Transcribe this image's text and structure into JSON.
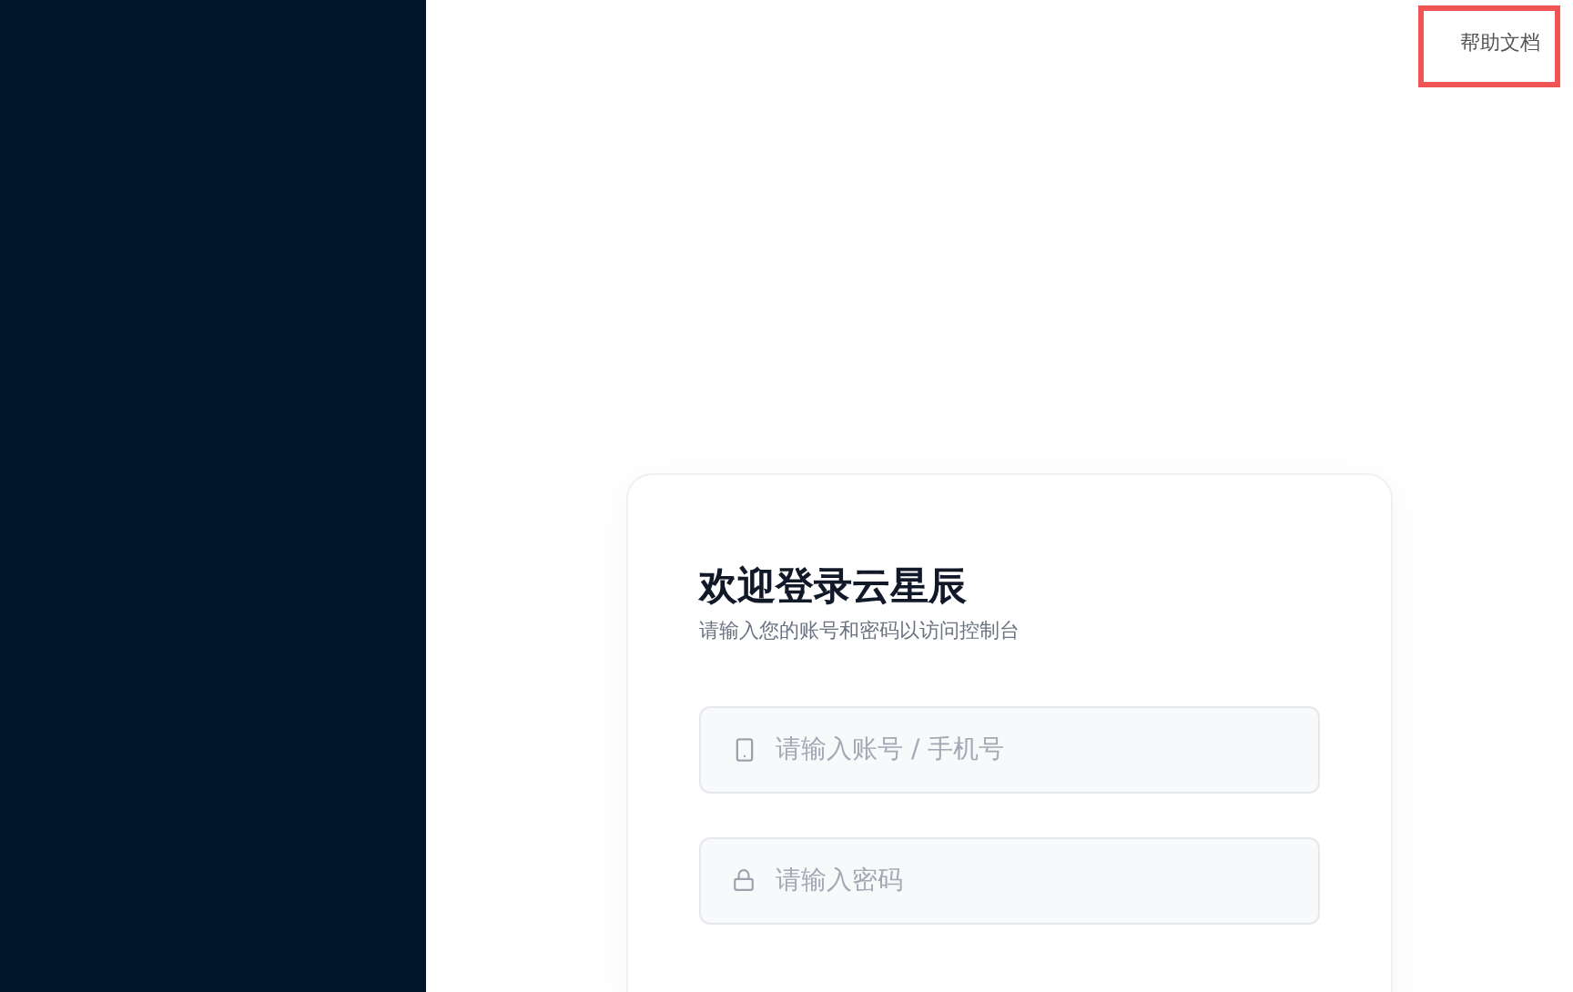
{
  "help_link": {
    "label": "帮助文档",
    "highlighted": true
  },
  "login_card": {
    "title": "欢迎登录云星辰",
    "subtitle": "请输入您的账号和密码以访问控制台",
    "fields": [
      {
        "kind": "phone",
        "placeholder": "请输入账号 / 手机号"
      },
      {
        "kind": "password",
        "placeholder": "请输入密码"
      }
    ]
  }
}
